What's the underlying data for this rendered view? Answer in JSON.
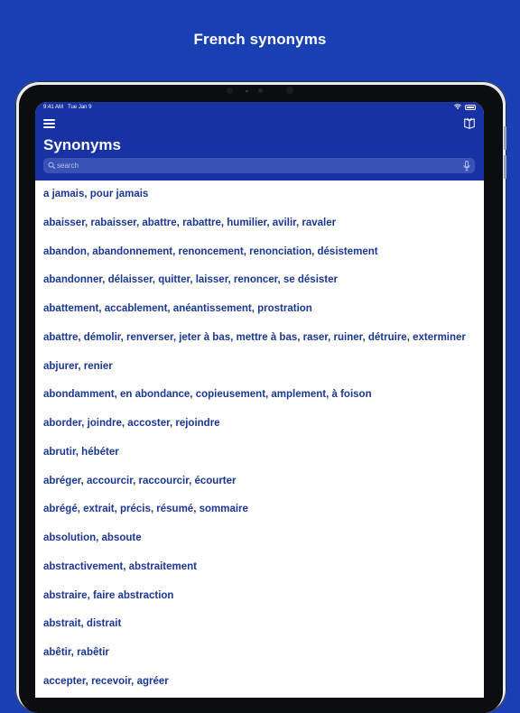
{
  "promo": {
    "title": "French synonyms"
  },
  "status_bar": {
    "time": "9:41 AM",
    "date": "Tue Jan 9"
  },
  "header": {
    "title": "Synonyms",
    "menu_icon": "hamburger-menu-icon",
    "book_icon": "open-book-icon"
  },
  "search": {
    "placeholder": "search",
    "value": "",
    "mic_icon": "microphone-icon"
  },
  "colors": {
    "background": "#1840b3",
    "header": "#1632a3",
    "text": "#1a3796"
  },
  "items": [
    "a jamais, pour jamais",
    "abaisser, rabaisser, abattre, rabattre, humilier, avilir, ravaler",
    "abandon, abandonnement, renoncement, renonciation, désistement",
    "abandonner, délaisser, quitter, laisser, renoncer, se désister",
    "abattement, accablement, anéantissement, prostration",
    "abattre, démolir, renverser, jeter à bas, mettre à bas, raser, ruiner, détruire, exterminer",
    "abjurer, renier",
    "abondamment, en abondance, copieusement, amplement, à foison",
    "aborder, joindre, accoster, rejoindre",
    "abrutir, hébéter",
    "abréger, accourcir, raccourcir, écourter",
    "abrégé, extrait, précis, résumé, sommaire",
    "absolution, absoute",
    "abstractivement, abstraitement",
    "abstraire, faire abstraction",
    "abstrait, distrait",
    "abêtir, rabêtir",
    "accepter, recevoir, agréer"
  ]
}
